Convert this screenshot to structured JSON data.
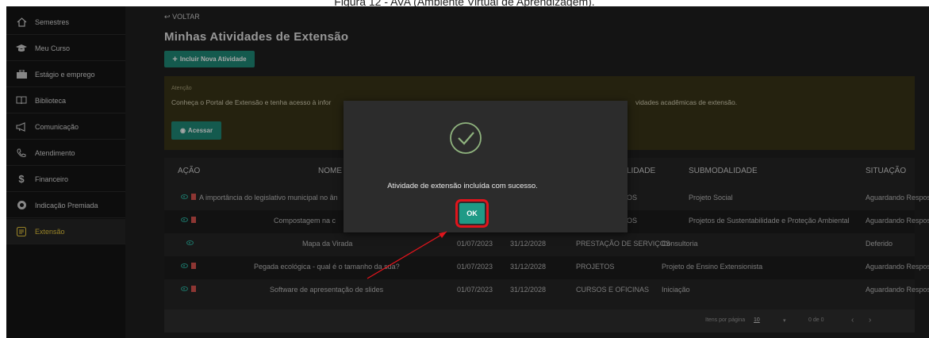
{
  "caption": "Figura 12 - AVA (Ambiente Virtual de Aprendizagem).",
  "sidebar": {
    "items": [
      {
        "label": "Semestres"
      },
      {
        "label": "Meu Curso"
      },
      {
        "label": "Estágio e emprego"
      },
      {
        "label": "Biblioteca"
      },
      {
        "label": "Comunicação"
      },
      {
        "label": "Atendimento"
      },
      {
        "label": "Financeiro"
      },
      {
        "label": "Indicação Premiada"
      },
      {
        "label": "Extensão"
      }
    ]
  },
  "header": {
    "back_label": "VOLTAR",
    "title": "Minhas Atividades de Extensão",
    "add_button": "Incluir Nova Atividade"
  },
  "notice": {
    "title": "Atenção",
    "text_left": "Conheça o Portal de Extensão e tenha acesso à infor",
    "text_right": "vidades acadêmicas de extensão.",
    "button": "Acessar"
  },
  "table": {
    "headers": {
      "acao": "AÇÃO",
      "nome": "NOME",
      "modalidade": "LIDADE",
      "submodalidade": "SUBMODALIDADE",
      "situacao": "SITUAÇÃO"
    },
    "rows": [
      {
        "nome": "A importância do legislativo municipal no ân",
        "inicio": "",
        "fim": "",
        "modalidade": "OS",
        "submodalidade": "Projeto Social",
        "situacao": "Aguardando Resposta"
      },
      {
        "nome": "Compostagem na c",
        "inicio": "",
        "fim": "",
        "modalidade": "OS",
        "submodalidade": "Projetos de Sustentabilidade e Proteção Ambiental",
        "situacao": "Aguardando Resposta"
      },
      {
        "nome": "Mapa da Virada",
        "inicio": "01/07/2023",
        "fim": "31/12/2028",
        "modalidade": "PRESTAÇÃO DE SERVIÇOS",
        "submodalidade": "Consultoria",
        "situacao": "Deferido"
      },
      {
        "nome": "Pegada ecológica - qual é o tamanho da sua?",
        "inicio": "01/07/2023",
        "fim": "31/12/2028",
        "modalidade": "PROJETOS",
        "submodalidade": "Projeto de Ensino Extensionista",
        "situacao": "Aguardando Resposta"
      },
      {
        "nome": "Software de apresentação de slides",
        "inicio": "01/07/2023",
        "fim": "31/12/2028",
        "modalidade": "CURSOS E OFICINAS",
        "submodalidade": "Iniciação",
        "situacao": "Aguardando Resposta"
      }
    ],
    "footer": {
      "per_page_label": "Itens por página",
      "per_page_value": "10",
      "range": "0 de 0"
    }
  },
  "modal": {
    "message": "Atividade de extensão incluída com sucesso.",
    "ok_label": "OK"
  },
  "colors": {
    "accent": "#1f8a78",
    "highlight": "#e0141c",
    "active": "#e8c83c"
  }
}
